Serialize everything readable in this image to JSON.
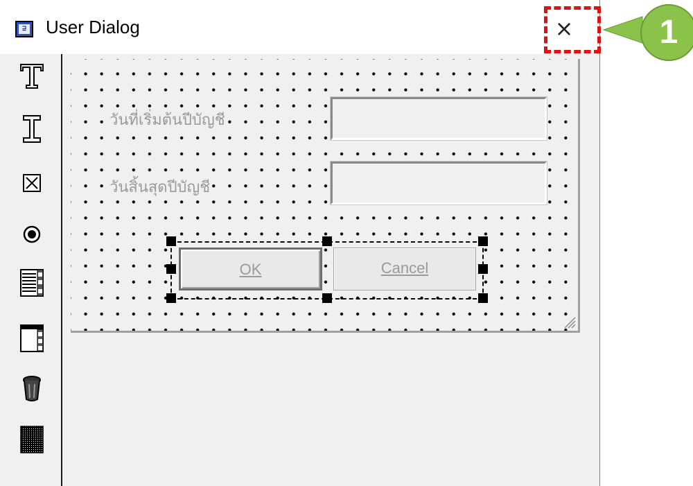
{
  "window": {
    "title": "User Dialog",
    "icon": "dialog-app-icon",
    "icon_text": "⊒",
    "close_label": "×"
  },
  "annotation": {
    "number": "1",
    "color": "#8bc34a",
    "highlight_color": "#e01212"
  },
  "toolbox": {
    "tools": [
      {
        "name": "text-tool",
        "icon": "text-T-icon"
      },
      {
        "name": "edit-box-tool",
        "icon": "text-cursor-icon"
      },
      {
        "name": "check-box-tool",
        "icon": "checkbox-icon"
      },
      {
        "name": "option-button-tool",
        "icon": "radio-icon"
      },
      {
        "name": "list-box-tool",
        "icon": "list-box-icon"
      },
      {
        "name": "combo-box-tool",
        "icon": "combo-box-icon"
      },
      {
        "name": "delete-tool",
        "icon": "trash-icon"
      },
      {
        "name": "grid-tool",
        "icon": "grid-icon"
      }
    ]
  },
  "design": {
    "fields": [
      {
        "label": "วันที่เริ่มต้นปีบัญชี",
        "value": ""
      },
      {
        "label": "วันสิ้นสุดปีบัญชี",
        "value": ""
      }
    ],
    "ok_label": "OK",
    "cancel_label": "Cancel"
  }
}
